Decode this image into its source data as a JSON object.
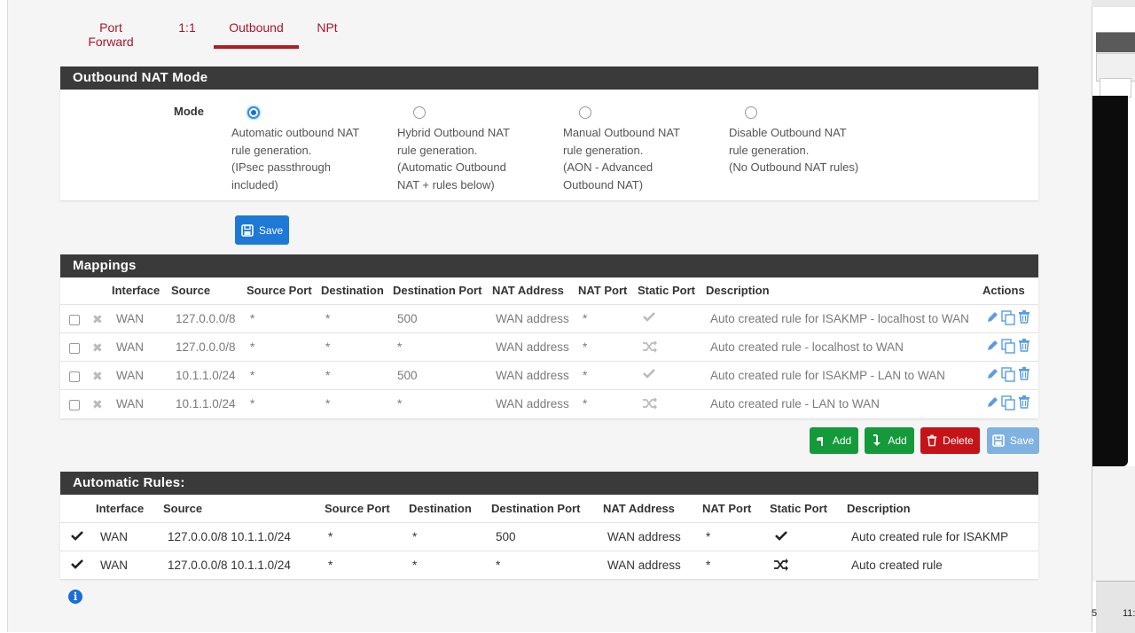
{
  "tabs": [
    {
      "label": "Port Forward"
    },
    {
      "label": "1:1"
    },
    {
      "label": "Outbound"
    },
    {
      "label": "NPt"
    }
  ],
  "active_tab": "Outbound",
  "nat_mode": {
    "title": "Outbound NAT Mode",
    "mode_label": "Mode",
    "selected": "automatic",
    "options": [
      {
        "id": "automatic",
        "text": "Automatic outbound NAT\nrule generation.\n(IPsec passthrough\nincluded)"
      },
      {
        "id": "hybrid",
        "text": "Hybrid Outbound NAT\nrule generation.\n(Automatic Outbound\nNAT + rules below)"
      },
      {
        "id": "manual",
        "text": "Manual Outbound NAT\nrule generation.\n(AON - Advanced\nOutbound NAT)"
      },
      {
        "id": "disable",
        "text": "Disable Outbound NAT\nrule generation.\n(No Outbound NAT rules)"
      }
    ],
    "save_label": "Save"
  },
  "mappings": {
    "title": "Mappings",
    "columns": [
      "Interface",
      "Source",
      "Source Port",
      "Destination",
      "Destination Port",
      "NAT Address",
      "NAT Port",
      "Static Port",
      "Description",
      "Actions"
    ],
    "rows": [
      {
        "interface": "WAN",
        "source": "127.0.0.0/8",
        "source_port": "*",
        "destination": "*",
        "destination_port": "500",
        "nat_address": "WAN address",
        "nat_port": "*",
        "static_port": "check-icon",
        "description": "Auto created rule for ISAKMP - localhost to WAN"
      },
      {
        "interface": "WAN",
        "source": "127.0.0.0/8",
        "source_port": "*",
        "destination": "*",
        "destination_port": "*",
        "nat_address": "WAN address",
        "nat_port": "*",
        "static_port": "shuffle-icon",
        "description": "Auto created rule - localhost to WAN"
      },
      {
        "interface": "WAN",
        "source": "10.1.1.0/24",
        "source_port": "*",
        "destination": "*",
        "destination_port": "500",
        "nat_address": "WAN address",
        "nat_port": "*",
        "static_port": "check-icon",
        "description": "Auto created rule for ISAKMP - LAN to WAN"
      },
      {
        "interface": "WAN",
        "source": "10.1.1.0/24",
        "source_port": "*",
        "destination": "*",
        "destination_port": "*",
        "nat_address": "WAN address",
        "nat_port": "*",
        "static_port": "shuffle-icon",
        "description": "Auto created rule - LAN to WAN"
      }
    ],
    "buttons": {
      "add_top": "Add",
      "add_bottom": "Add",
      "delete": "Delete",
      "save": "Save"
    }
  },
  "auto_rules": {
    "title": "Automatic Rules:",
    "columns": [
      "Interface",
      "Source",
      "Source Port",
      "Destination",
      "Destination Port",
      "NAT Address",
      "NAT Port",
      "Static Port",
      "Description"
    ],
    "rows": [
      {
        "interface": "WAN",
        "source": "127.0.0.0/8 10.1.1.0/24",
        "source_port": "*",
        "destination": "*",
        "destination_port": "500",
        "nat_address": "WAN address",
        "nat_port": "*",
        "static_port": "check-icon",
        "description": "Auto created rule for ISAKMP"
      },
      {
        "interface": "WAN",
        "source": "127.0.0.0/8 10.1.1.0/24",
        "source_port": "*",
        "destination": "*",
        "destination_port": "*",
        "nat_address": "WAN address",
        "nat_port": "*",
        "static_port": "shuffle-icon",
        "description": "Auto created rule"
      }
    ]
  },
  "colors": {
    "accent_red": "#b01c22",
    "header_dark": "#3a3a3a",
    "blue": "#1e78d6",
    "green": "#159a3b",
    "red": "#c4141a"
  },
  "background_window": {
    "fragment_a": "5",
    "fragment_b": "11:"
  }
}
